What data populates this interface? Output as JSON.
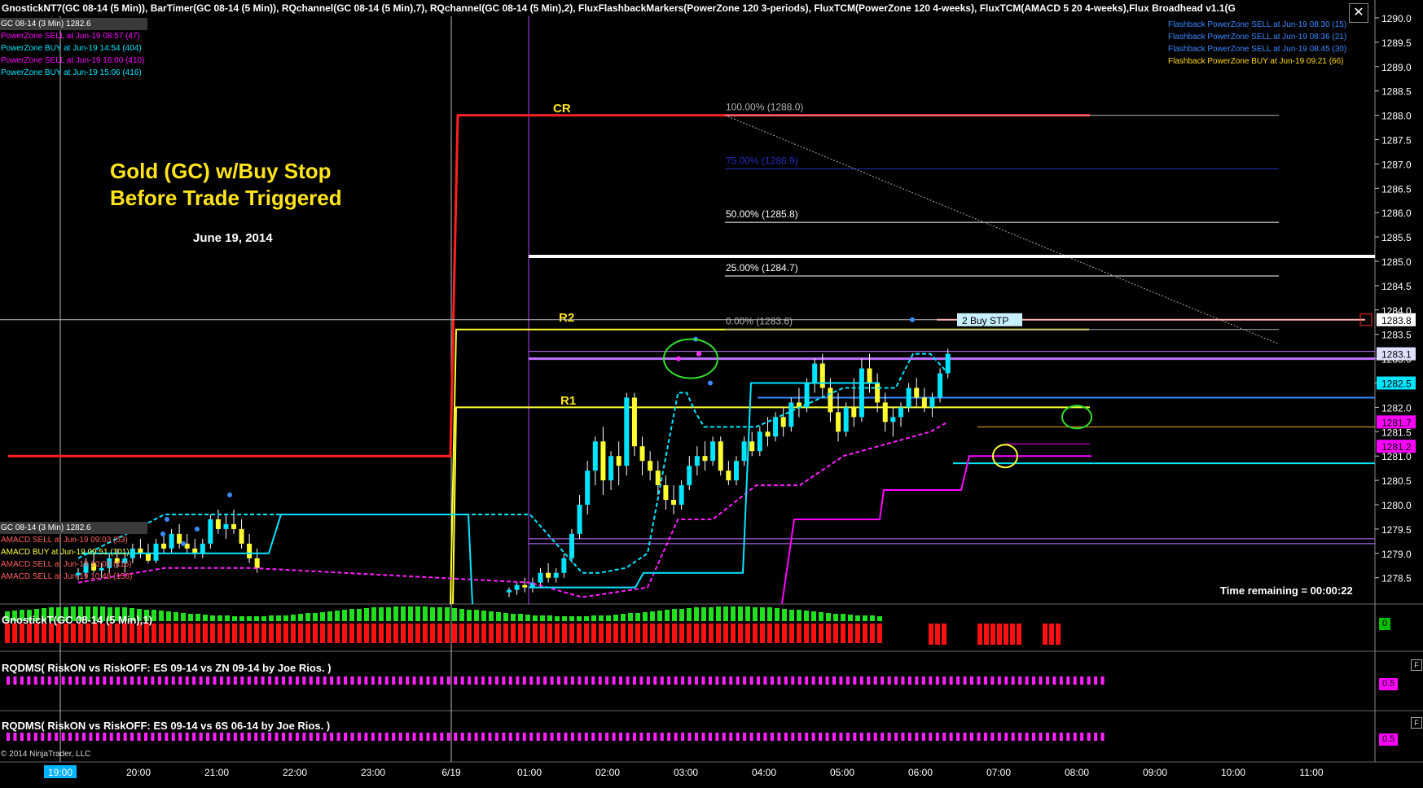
{
  "header": "GnostickNT7(GC 08-14 (5 Min)),  BarTimer(GC 08-14 (5 Min)),  RQchannel(GC 08-14 (5 Min),7),  RQchannel(GC 08-14 (5 Min),2),  FluxFlashbackMarkers(PowerZone 120 3-periods),  FluxTCM(PowerZone 120 4-weeks),  FluxTCM(AMACD 5  20 4-weeks),Flux Broadhead v1.1(G",
  "top_left": {
    "box": "GC 08-14 (3 Min) 1282.6",
    "lines": [
      {
        "text": "PowerZone SELL at Jun-19 08:57 (47)",
        "color": "#ff00ff"
      },
      {
        "text": "PowerZone BUY at Jun-19 14:54 (404)",
        "color": "#00e5ff"
      },
      {
        "text": "PowerZone SELL at Jun-19 16:00 (410)",
        "color": "#ff00ff"
      },
      {
        "text": "PowerZone BUY at Jun-19 15:06 (416)",
        "color": "#00e5ff"
      }
    ]
  },
  "top_right": {
    "lines": [
      {
        "text": "Flashback PowerZone SELL at Jun-19 08:30 (15)",
        "color": "#3a8aff"
      },
      {
        "text": "Flashback PowerZone SELL at Jun-19 08:36 (21)",
        "color": "#3a8aff"
      },
      {
        "text": "Flashback PowerZone SELL at Jun-19 08:45 (30)",
        "color": "#3a8aff"
      },
      {
        "text": "Flashback PowerZone BUY at Jun-19 09:21 (66)",
        "color": "#ffd700"
      }
    ]
  },
  "lower_left": {
    "box": "GC 08-14 (3 Min) 1282.6",
    "lines": [
      {
        "text": "AMACD SELL at Jun-19 09:03 (53)",
        "color": "#ff6060"
      },
      {
        "text": "AMACD BUY at Jun-19 09:51 (101)",
        "color": "#ffff40"
      },
      {
        "text": "AMACD SELL at Jun-19 10:06 (116)",
        "color": "#ff6060"
      },
      {
        "text": "AMACD SELL at Jun-19 10:48 (158)",
        "color": "#ff6060"
      }
    ]
  },
  "annotation": {
    "title_line1": "Gold (GC) w/Buy Stop",
    "title_line2": "Before Trade Triggered",
    "date": "June 19, 2014",
    "time_remaining": "Time remaining = 00:00:22",
    "buy_stop_label": "2  Buy STP"
  },
  "levels": {
    "CR": "CR",
    "R2": "R2",
    "R1": "R1",
    "fib": [
      {
        "label": "100.00% (1288.0)",
        "value": 1288.0,
        "color": "#b0b0b0"
      },
      {
        "label": "75.00% (1286.9)",
        "value": 1286.9,
        "color": "#2030c0"
      },
      {
        "label": "50.00% (1285.8)",
        "value": 1285.8,
        "color": "#ffffff"
      },
      {
        "label": "25.00% (1284.7)",
        "value": 1284.7,
        "color": "#ffffff"
      },
      {
        "label": "0.00% (1283.6)",
        "value": 1283.6,
        "color": "#b0b0b0"
      }
    ]
  },
  "price_badges": [
    {
      "text": "1283.8",
      "value": 1283.8,
      "bg": "#ffffff",
      "fg": "#000000"
    },
    {
      "text": "1283.1",
      "value": 1283.1,
      "bg": "#e0e0ff",
      "fg": "#000000"
    },
    {
      "text": "1282.5",
      "value": 1282.5,
      "bg": "#00e5ff",
      "fg": "#000000"
    },
    {
      "text": "1281.7",
      "value": 1281.7,
      "bg": "#ff00ff",
      "fg": "#000000"
    },
    {
      "text": "1281.2",
      "value": 1281.2,
      "bg": "#ff00ff",
      "fg": "#000000"
    }
  ],
  "panels": {
    "gnostick": {
      "name": "GnostickT(GC 08-14 (5 Min),1)",
      "badge": "0",
      "badge_bg": "#00c000"
    },
    "rqdms1": {
      "name": "RQDMS( RiskON vs RiskOFF: ES 09-14 vs ZN 09-14  by Joe Rios.  )",
      "badge": "0.5",
      "badge_bg": "#ff00ff"
    },
    "rqdms2": {
      "name": "RQDMS( RiskON vs RiskOFF: ES 09-14 vs 6S 06-14  by Joe Rios.  )",
      "badge": "0.5",
      "badge_bg": "#ff00ff"
    },
    "f_label": "F"
  },
  "copyright": "© 2014 NinjaTrader, LLC",
  "chart_data": {
    "type": "candlestick",
    "title": "Gold (GC) w/Buy Stop Before Trade Triggered",
    "instrument": "GC 08-14 (5 Min)",
    "y_axis": {
      "ticks": [
        "1290.0",
        "1289.5",
        "1289.0",
        "1288.5",
        "1288.0",
        "1287.5",
        "1287.0",
        "1286.5",
        "1286.0",
        "1285.5",
        "1285.0",
        "1284.5",
        "1284.0",
        "1283.5",
        "1283.0",
        "1282.5",
        "1282.0",
        "1281.5",
        "1281.0",
        "1280.5",
        "1280.0",
        "1279.5",
        "1279.0",
        "1278.5"
      ],
      "ylim": [
        1278.1,
        1290.3
      ]
    },
    "x_axis": {
      "ticks": [
        "19:00",
        "20:00",
        "21:00",
        "22:00",
        "23:00",
        "6/19",
        "01:00",
        "02:00",
        "03:00",
        "04:00",
        "05:00",
        "06:00",
        "07:00",
        "08:00",
        "09:00",
        "10:00",
        "11:00"
      ],
      "highlight": "19:00"
    },
    "lines": {
      "CR": 1288.0,
      "R2": 1283.6,
      "R1": 1282.0,
      "pre_level": 1281.0,
      "buy_stop": 1283.8,
      "white_thick": 1285.1
    },
    "candles": [
      [
        1278.55,
        1278.7,
        1278.45,
        1278.6
      ],
      [
        1278.6,
        1278.9,
        1278.5,
        1278.8
      ],
      [
        1278.8,
        1279.0,
        1278.6,
        1278.65
      ],
      [
        1278.65,
        1278.8,
        1278.5,
        1278.7
      ],
      [
        1278.7,
        1279.0,
        1278.6,
        1278.9
      ],
      [
        1278.9,
        1279.1,
        1278.7,
        1278.8
      ],
      [
        1278.8,
        1279.0,
        1278.6,
        1278.9
      ],
      [
        1278.9,
        1279.2,
        1278.8,
        1279.1
      ],
      [
        1279.1,
        1279.3,
        1278.9,
        1279.0
      ],
      [
        1279.0,
        1279.2,
        1278.8,
        1278.85
      ],
      [
        1278.85,
        1279.3,
        1278.8,
        1279.2
      ],
      [
        1279.2,
        1279.4,
        1279.0,
        1279.1
      ],
      [
        1279.1,
        1279.5,
        1279.0,
        1279.4
      ],
      [
        1279.4,
        1279.6,
        1279.1,
        1279.2
      ],
      [
        1279.2,
        1279.4,
        1279.0,
        1279.1
      ],
      [
        1279.1,
        1279.3,
        1278.9,
        1279.0
      ],
      [
        1279.0,
        1279.3,
        1278.9,
        1279.2
      ],
      [
        1279.2,
        1279.8,
        1279.1,
        1279.7
      ],
      [
        1279.7,
        1279.9,
        1279.4,
        1279.5
      ],
      [
        1279.5,
        1279.8,
        1279.3,
        1279.6
      ],
      [
        1279.6,
        1279.9,
        1279.4,
        1279.5
      ],
      [
        1279.5,
        1279.7,
        1279.1,
        1279.2
      ],
      [
        1279.2,
        1279.4,
        1278.8,
        1278.9
      ],
      [
        1278.9,
        1279.1,
        1278.6,
        1278.7
      ],
      [
        1278.2,
        1278.3,
        1278.1,
        1278.25
      ],
      [
        1278.25,
        1278.4,
        1278.15,
        1278.35
      ],
      [
        1278.35,
        1278.5,
        1278.2,
        1278.3
      ],
      [
        1278.3,
        1278.5,
        1278.2,
        1278.4
      ],
      [
        1278.4,
        1278.7,
        1278.3,
        1278.6
      ],
      [
        1278.6,
        1278.8,
        1278.4,
        1278.5
      ],
      [
        1278.5,
        1278.7,
        1278.4,
        1278.6
      ],
      [
        1278.6,
        1279.0,
        1278.5,
        1278.9
      ],
      [
        1278.9,
        1279.5,
        1278.8,
        1279.4
      ],
      [
        1279.4,
        1280.2,
        1279.3,
        1280.0
      ],
      [
        1280.0,
        1280.9,
        1279.8,
        1280.7
      ],
      [
        1280.7,
        1281.4,
        1280.4,
        1281.3
      ],
      [
        1281.3,
        1281.6,
        1280.2,
        1280.5
      ],
      [
        1280.5,
        1281.1,
        1280.3,
        1281.0
      ],
      [
        1281.0,
        1281.3,
        1280.4,
        1280.8
      ],
      [
        1280.8,
        1282.3,
        1280.6,
        1282.2
      ],
      [
        1282.2,
        1282.3,
        1281.0,
        1281.2
      ],
      [
        1281.2,
        1281.4,
        1280.6,
        1280.9
      ],
      [
        1280.9,
        1281.1,
        1280.5,
        1280.7
      ],
      [
        1280.7,
        1280.9,
        1280.2,
        1280.4
      ],
      [
        1280.4,
        1280.6,
        1279.9,
        1280.1
      ],
      [
        1280.1,
        1280.4,
        1279.8,
        1280.0
      ],
      [
        1280.0,
        1280.5,
        1279.9,
        1280.4
      ],
      [
        1280.4,
        1281.0,
        1280.3,
        1280.8
      ],
      [
        1280.8,
        1281.2,
        1280.6,
        1281.0
      ],
      [
        1281.0,
        1281.3,
        1280.7,
        1280.9
      ],
      [
        1280.9,
        1281.4,
        1280.8,
        1281.3
      ],
      [
        1281.3,
        1281.4,
        1280.6,
        1280.7
      ],
      [
        1280.7,
        1280.9,
        1280.4,
        1280.5
      ],
      [
        1280.5,
        1281.0,
        1280.4,
        1280.9
      ],
      [
        1280.9,
        1281.4,
        1280.8,
        1281.3
      ],
      [
        1281.3,
        1281.5,
        1281.0,
        1281.1
      ],
      [
        1281.1,
        1281.6,
        1281.0,
        1281.5
      ],
      [
        1281.5,
        1281.8,
        1281.2,
        1281.4
      ],
      [
        1281.4,
        1281.9,
        1281.3,
        1281.8
      ],
      [
        1281.8,
        1282.0,
        1281.4,
        1281.6
      ],
      [
        1281.6,
        1282.2,
        1281.5,
        1282.1
      ],
      [
        1282.1,
        1282.4,
        1281.8,
        1282.0
      ],
      [
        1282.0,
        1282.6,
        1281.9,
        1282.5
      ],
      [
        1282.5,
        1283.0,
        1282.3,
        1282.9
      ],
      [
        1282.9,
        1283.1,
        1282.2,
        1282.4
      ],
      [
        1282.4,
        1282.6,
        1281.7,
        1281.9
      ],
      [
        1281.9,
        1282.3,
        1281.3,
        1281.5
      ],
      [
        1281.5,
        1282.1,
        1281.4,
        1282.0
      ],
      [
        1282.0,
        1282.6,
        1281.6,
        1281.8
      ],
      [
        1281.8,
        1283.0,
        1281.7,
        1282.8
      ],
      [
        1282.8,
        1283.1,
        1282.3,
        1282.5
      ],
      [
        1282.5,
        1282.7,
        1281.9,
        1282.1
      ],
      [
        1282.1,
        1282.3,
        1281.5,
        1281.7
      ],
      [
        1281.7,
        1282.0,
        1281.4,
        1281.8
      ],
      [
        1281.8,
        1282.1,
        1281.6,
        1282.0
      ],
      [
        1282.0,
        1282.5,
        1281.9,
        1282.4
      ],
      [
        1282.4,
        1282.6,
        1282.0,
        1282.2
      ],
      [
        1282.2,
        1282.4,
        1281.9,
        1282.0
      ],
      [
        1282.0,
        1282.3,
        1281.8,
        1282.2
      ],
      [
        1282.2,
        1282.8,
        1282.1,
        1282.7
      ],
      [
        1282.7,
        1283.2,
        1282.6,
        1283.1
      ]
    ],
    "ma_cyan": [
      [
        0,
        1278.9
      ],
      [
        20,
        1279.8
      ],
      [
        40,
        1279.8
      ],
      [
        48,
        1279.8
      ],
      [
        60,
        1278.6
      ],
      [
        64,
        1278.6
      ],
      [
        70,
        1278.7
      ],
      [
        75,
        1279.0
      ],
      [
        82,
        1282.3
      ],
      [
        84,
        1282.3
      ],
      [
        86,
        1281.9
      ],
      [
        88,
        1281.6
      ],
      [
        100,
        1281.6
      ],
      [
        105,
        1281.8
      ],
      [
        120,
        1282.4
      ],
      [
        132,
        1282.4
      ],
      [
        136,
        1283.1
      ],
      [
        140,
        1283.1
      ],
      [
        144,
        1282.7
      ]
    ],
    "ma_magenta": [
      [
        0,
        1278.4
      ],
      [
        20,
        1278.7
      ],
      [
        40,
        1278.7
      ],
      [
        48,
        1278.4
      ],
      [
        60,
        1278.1
      ],
      [
        75,
        1278.3
      ],
      [
        82,
        1279.7
      ],
      [
        90,
        1279.7
      ],
      [
        100,
        1280.4
      ],
      [
        110,
        1280.4
      ],
      [
        120,
        1281.0
      ],
      [
        132,
        1281.3
      ],
      [
        140,
        1281.5
      ],
      [
        144,
        1281.7
      ]
    ],
    "gnostick_bars": "green above / red below histogram",
    "rqdms": "0.5"
  }
}
